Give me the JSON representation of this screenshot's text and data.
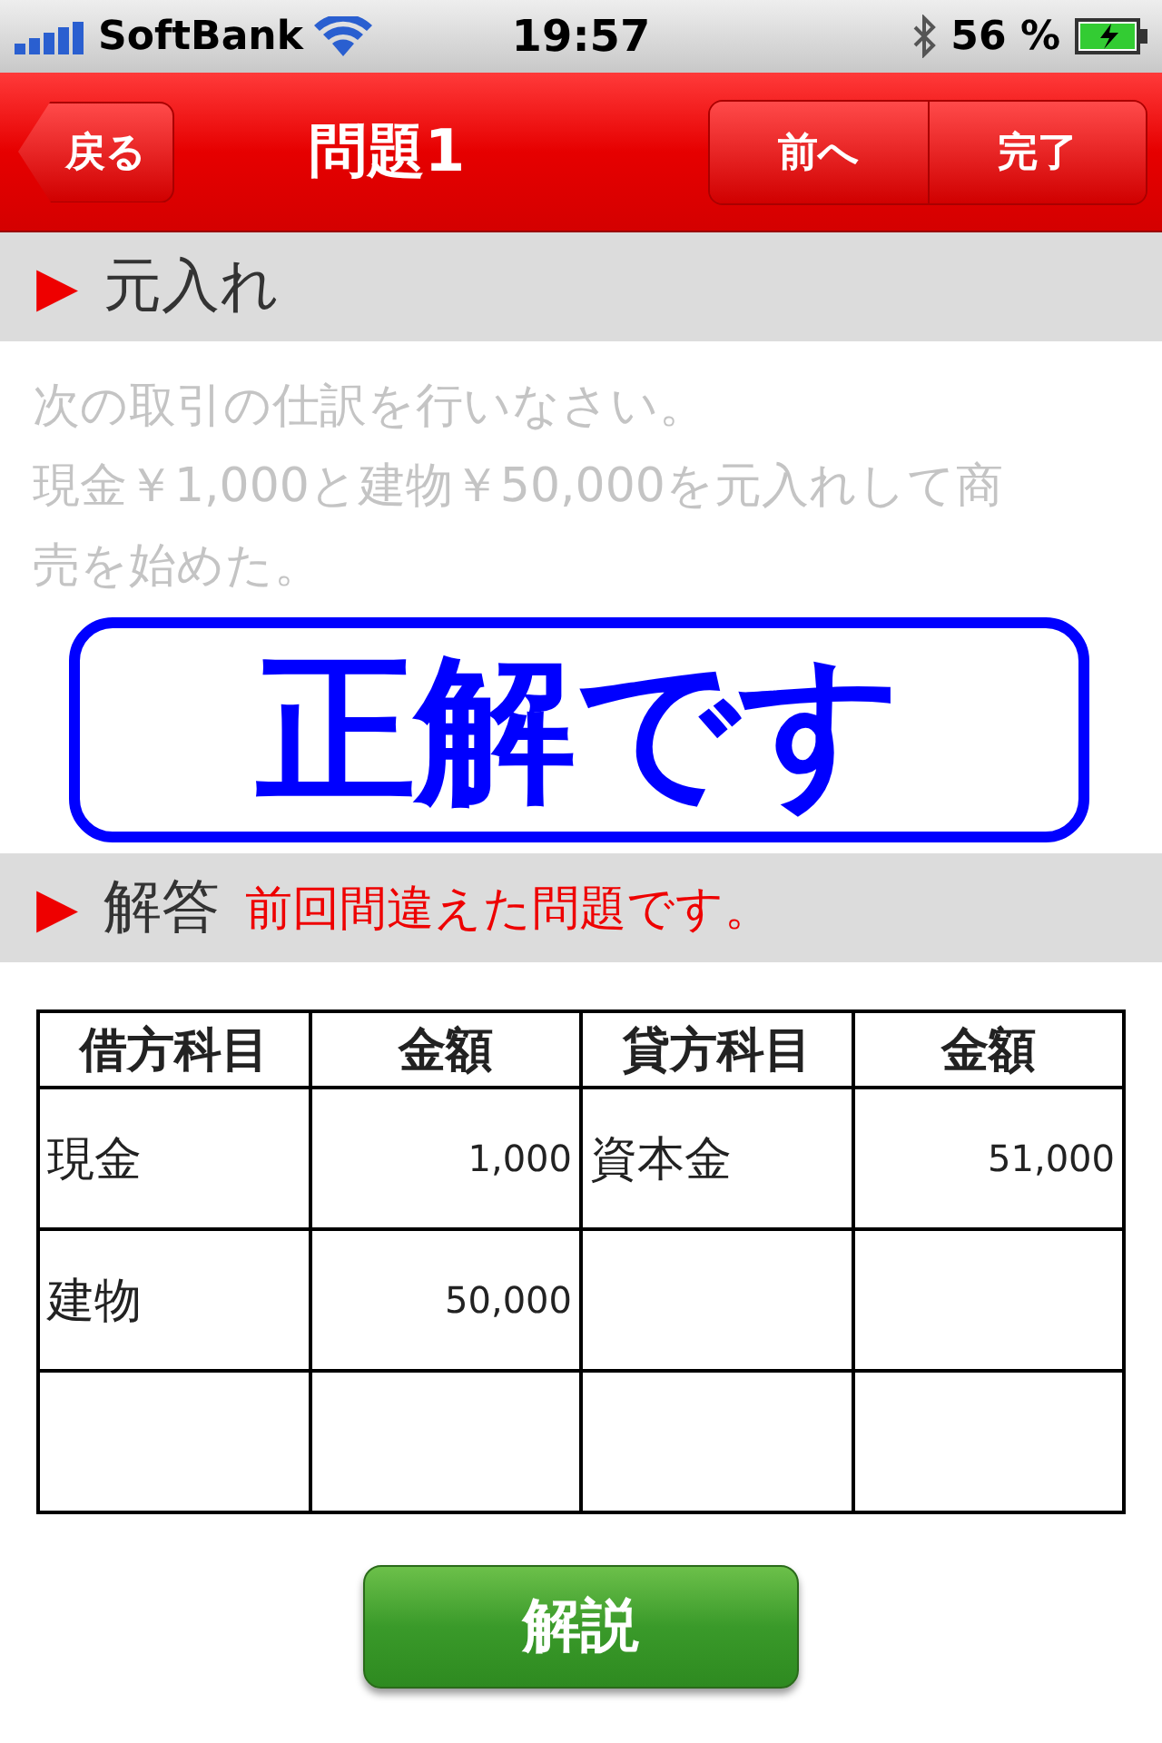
{
  "status_bar": {
    "carrier": "SoftBank",
    "time": "19:57",
    "battery": "56 %"
  },
  "nav_bar": {
    "back": "戻る",
    "title": "問題1",
    "buttons": [
      {
        "label": "前へ"
      },
      {
        "label": "完了"
      }
    ]
  },
  "question_section": {
    "marker": "▶",
    "title": "元入れ"
  },
  "question": {
    "lines": [
      "次の取引の仕訳を行いなさい。",
      "現金￥1,000と建物￥50,000を元入れして商",
      "売を始めた。"
    ]
  },
  "result_overlay": {
    "text": "正解です"
  },
  "answer_section": {
    "marker": "▶",
    "title": "解答",
    "note": "前回間違えた問題です。"
  },
  "table": {
    "columns": [
      "借方科目",
      "金額",
      "貸方科目",
      "金額"
    ],
    "rows": [
      [
        "現金",
        "1,000",
        "資本金",
        "51,000"
      ],
      [
        "建物",
        "50,000",
        "",
        ""
      ],
      [
        "",
        "",
        "",
        ""
      ]
    ]
  },
  "explain_button": {
    "label": "解説"
  }
}
